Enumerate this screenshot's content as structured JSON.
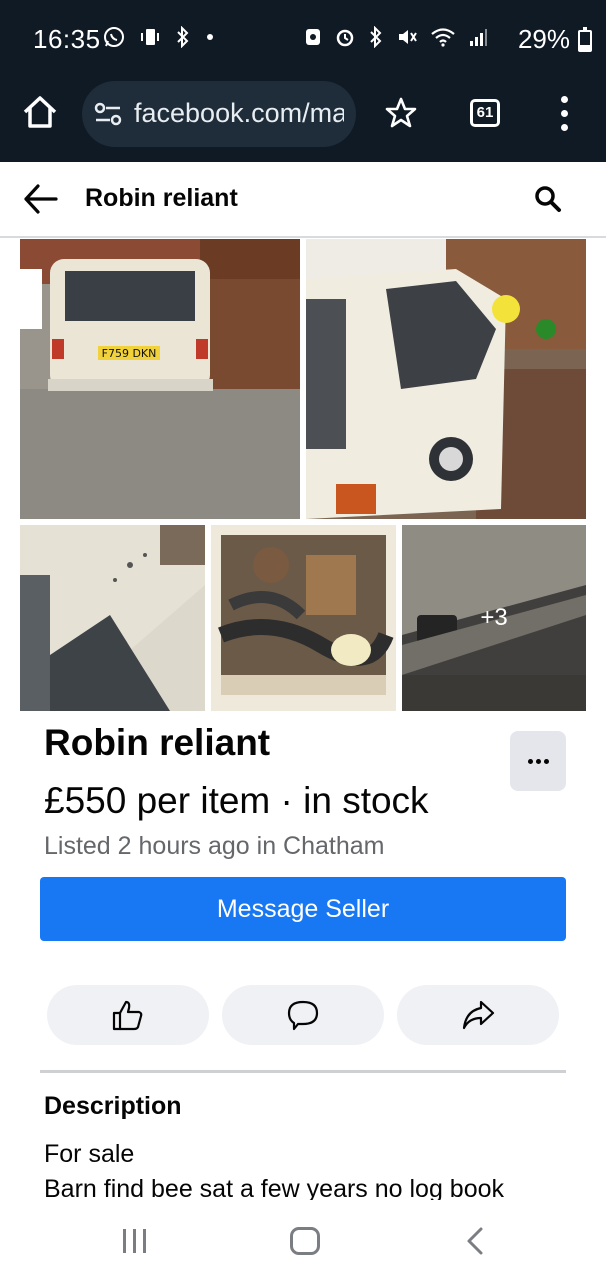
{
  "status_bar": {
    "time": "16:35",
    "battery_percent": "29%",
    "battery_level": 0.29,
    "left_icons": [
      "whatsapp-icon",
      "vibrate-icon",
      "bluetooth-icon",
      "dot-icon"
    ],
    "right_icons": [
      "screenshot-icon",
      "alarm-icon",
      "bluetooth-icon",
      "mute-icon",
      "wifi-icon",
      "signal-icon"
    ]
  },
  "browser": {
    "url": "facebook.com/ma",
    "tab_count": "61"
  },
  "header": {
    "title": "Robin reliant"
  },
  "photos": {
    "more_count": "+3",
    "plate_text": "F759 DKN"
  },
  "listing": {
    "title": "Robin reliant",
    "price": "£550 per item · in stock",
    "meta": "Listed 2 hours ago in Chatham",
    "message_button": "Message Seller"
  },
  "actions": [
    "like-icon",
    "comment-icon",
    "share-icon"
  ],
  "description": {
    "heading": "Description",
    "lines": [
      "For sale",
      "Barn find bee sat a few years no log book"
    ]
  },
  "colors": {
    "accent": "#1877f2",
    "status_bg": "#0f1a24",
    "secondary_text": "#65676b"
  }
}
